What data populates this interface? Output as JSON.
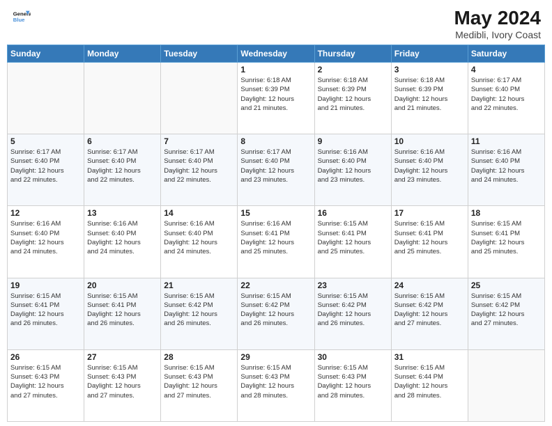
{
  "header": {
    "logo_line1": "General",
    "logo_line2": "Blue",
    "title": "May 2024",
    "location": "Medibli, Ivory Coast"
  },
  "weekdays": [
    "Sunday",
    "Monday",
    "Tuesday",
    "Wednesday",
    "Thursday",
    "Friday",
    "Saturday"
  ],
  "weeks": [
    [
      {
        "day": "",
        "info": ""
      },
      {
        "day": "",
        "info": ""
      },
      {
        "day": "",
        "info": ""
      },
      {
        "day": "1",
        "info": "Sunrise: 6:18 AM\nSunset: 6:39 PM\nDaylight: 12 hours\nand 21 minutes."
      },
      {
        "day": "2",
        "info": "Sunrise: 6:18 AM\nSunset: 6:39 PM\nDaylight: 12 hours\nand 21 minutes."
      },
      {
        "day": "3",
        "info": "Sunrise: 6:18 AM\nSunset: 6:39 PM\nDaylight: 12 hours\nand 21 minutes."
      },
      {
        "day": "4",
        "info": "Sunrise: 6:17 AM\nSunset: 6:40 PM\nDaylight: 12 hours\nand 22 minutes."
      }
    ],
    [
      {
        "day": "5",
        "info": "Sunrise: 6:17 AM\nSunset: 6:40 PM\nDaylight: 12 hours\nand 22 minutes."
      },
      {
        "day": "6",
        "info": "Sunrise: 6:17 AM\nSunset: 6:40 PM\nDaylight: 12 hours\nand 22 minutes."
      },
      {
        "day": "7",
        "info": "Sunrise: 6:17 AM\nSunset: 6:40 PM\nDaylight: 12 hours\nand 22 minutes."
      },
      {
        "day": "8",
        "info": "Sunrise: 6:17 AM\nSunset: 6:40 PM\nDaylight: 12 hours\nand 23 minutes."
      },
      {
        "day": "9",
        "info": "Sunrise: 6:16 AM\nSunset: 6:40 PM\nDaylight: 12 hours\nand 23 minutes."
      },
      {
        "day": "10",
        "info": "Sunrise: 6:16 AM\nSunset: 6:40 PM\nDaylight: 12 hours\nand 23 minutes."
      },
      {
        "day": "11",
        "info": "Sunrise: 6:16 AM\nSunset: 6:40 PM\nDaylight: 12 hours\nand 24 minutes."
      }
    ],
    [
      {
        "day": "12",
        "info": "Sunrise: 6:16 AM\nSunset: 6:40 PM\nDaylight: 12 hours\nand 24 minutes."
      },
      {
        "day": "13",
        "info": "Sunrise: 6:16 AM\nSunset: 6:40 PM\nDaylight: 12 hours\nand 24 minutes."
      },
      {
        "day": "14",
        "info": "Sunrise: 6:16 AM\nSunset: 6:40 PM\nDaylight: 12 hours\nand 24 minutes."
      },
      {
        "day": "15",
        "info": "Sunrise: 6:16 AM\nSunset: 6:41 PM\nDaylight: 12 hours\nand 25 minutes."
      },
      {
        "day": "16",
        "info": "Sunrise: 6:15 AM\nSunset: 6:41 PM\nDaylight: 12 hours\nand 25 minutes."
      },
      {
        "day": "17",
        "info": "Sunrise: 6:15 AM\nSunset: 6:41 PM\nDaylight: 12 hours\nand 25 minutes."
      },
      {
        "day": "18",
        "info": "Sunrise: 6:15 AM\nSunset: 6:41 PM\nDaylight: 12 hours\nand 25 minutes."
      }
    ],
    [
      {
        "day": "19",
        "info": "Sunrise: 6:15 AM\nSunset: 6:41 PM\nDaylight: 12 hours\nand 26 minutes."
      },
      {
        "day": "20",
        "info": "Sunrise: 6:15 AM\nSunset: 6:41 PM\nDaylight: 12 hours\nand 26 minutes."
      },
      {
        "day": "21",
        "info": "Sunrise: 6:15 AM\nSunset: 6:42 PM\nDaylight: 12 hours\nand 26 minutes."
      },
      {
        "day": "22",
        "info": "Sunrise: 6:15 AM\nSunset: 6:42 PM\nDaylight: 12 hours\nand 26 minutes."
      },
      {
        "day": "23",
        "info": "Sunrise: 6:15 AM\nSunset: 6:42 PM\nDaylight: 12 hours\nand 26 minutes."
      },
      {
        "day": "24",
        "info": "Sunrise: 6:15 AM\nSunset: 6:42 PM\nDaylight: 12 hours\nand 27 minutes."
      },
      {
        "day": "25",
        "info": "Sunrise: 6:15 AM\nSunset: 6:42 PM\nDaylight: 12 hours\nand 27 minutes."
      }
    ],
    [
      {
        "day": "26",
        "info": "Sunrise: 6:15 AM\nSunset: 6:43 PM\nDaylight: 12 hours\nand 27 minutes."
      },
      {
        "day": "27",
        "info": "Sunrise: 6:15 AM\nSunset: 6:43 PM\nDaylight: 12 hours\nand 27 minutes."
      },
      {
        "day": "28",
        "info": "Sunrise: 6:15 AM\nSunset: 6:43 PM\nDaylight: 12 hours\nand 27 minutes."
      },
      {
        "day": "29",
        "info": "Sunrise: 6:15 AM\nSunset: 6:43 PM\nDaylight: 12 hours\nand 28 minutes."
      },
      {
        "day": "30",
        "info": "Sunrise: 6:15 AM\nSunset: 6:43 PM\nDaylight: 12 hours\nand 28 minutes."
      },
      {
        "day": "31",
        "info": "Sunrise: 6:15 AM\nSunset: 6:44 PM\nDaylight: 12 hours\nand 28 minutes."
      },
      {
        "day": "",
        "info": ""
      }
    ]
  ]
}
